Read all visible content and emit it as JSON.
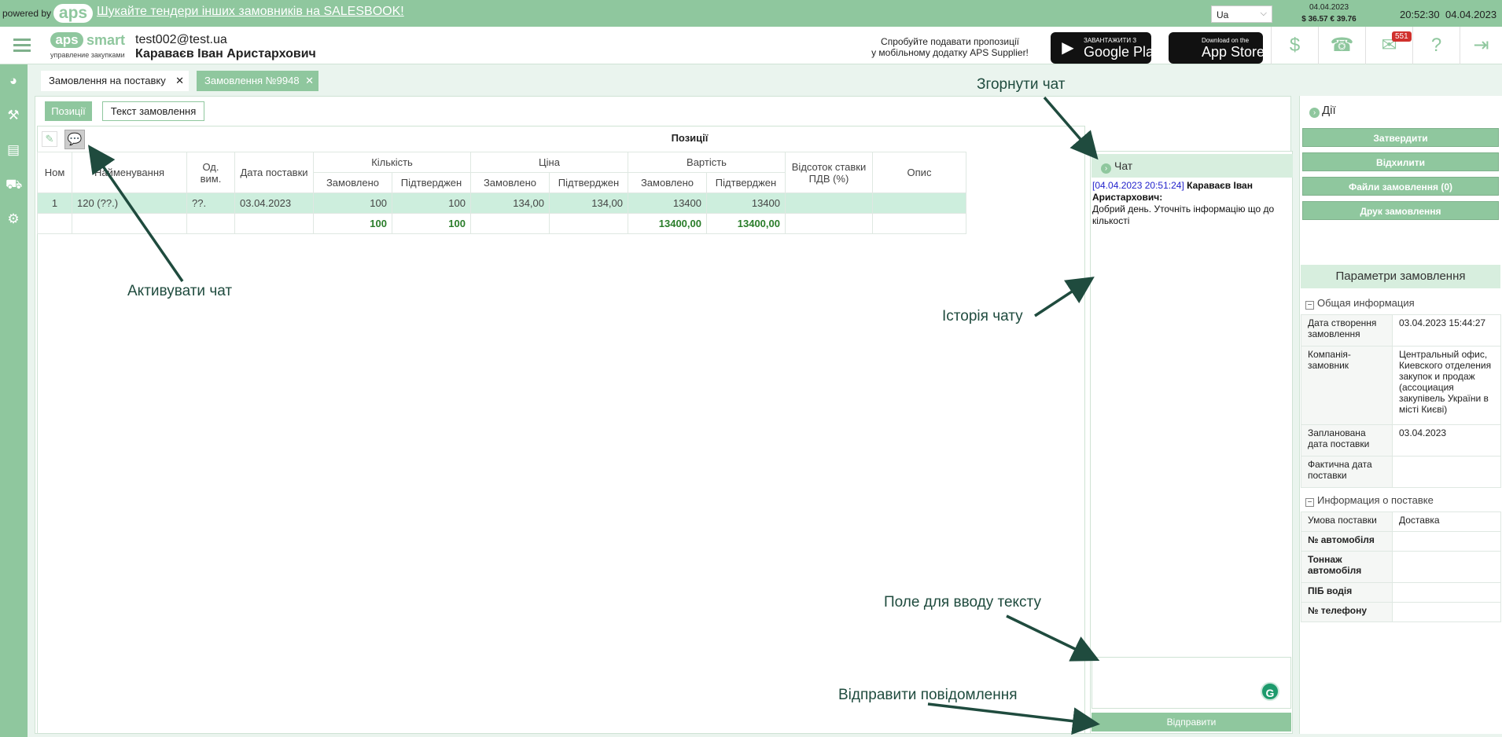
{
  "topbar": {
    "powered_by": "powered by",
    "logo": "aps",
    "promo_link": "Шукайте тендери інших замовників на SALESBOOK!",
    "language": "Ua",
    "rates_date": "04.04.2023",
    "rates": "$ 36.57  € 39.76",
    "time": "20:52:30",
    "date": "04.04.2023"
  },
  "header": {
    "brand_aps": "aps",
    "brand_smart": "smart",
    "brand_tagline": "управление закупками",
    "user_email": "test002@test.ua",
    "user_name": "Караваєв Іван Аристархович",
    "mobile_promo_1": "Спробуйте подавати пропозиції",
    "mobile_promo_2": "у мобільному додатку APS Supplier!",
    "google_small": "ЗАВАНТАЖИТИ З",
    "google_large": "Google Play",
    "apple_small": "Download on the",
    "apple_large": "App Store",
    "mail_badge": "551"
  },
  "tabs": [
    {
      "label": "Замовлення на поставку"
    },
    {
      "label": "Замовлення №9948"
    }
  ],
  "subtabs": {
    "positions": "Позиції",
    "order_text": "Текст замовлення"
  },
  "grid": {
    "title": "Позиції",
    "columns": {
      "num": "Ном",
      "name": "Найменування",
      "unit": "Од. вим.",
      "delivery_date": "Дата поставки",
      "quantity": "Кількість",
      "price": "Ціна",
      "cost": "Вартість",
      "vat": "Відсоток ставки ПДВ (%)",
      "description": "Опис",
      "ordered": "Замовлено",
      "confirmed": "Підтверджен"
    },
    "rows": [
      {
        "num": "1",
        "name": "120 (??.)",
        "unit": "??.",
        "date": "03.04.2023",
        "qty_ordered": "100",
        "qty_confirmed": "100",
        "price_ordered": "134,00",
        "price_confirmed": "134,00",
        "cost_ordered": "13400",
        "cost_confirmed": "13400"
      }
    ],
    "totals": {
      "qty_ordered": "100",
      "qty_confirmed": "100",
      "cost_ordered": "13400,00",
      "cost_confirmed": "13400,00"
    }
  },
  "chat": {
    "title": "Чат",
    "message": {
      "timestamp": "[04.04.2023 20:51:24]",
      "author": "Караваєв Іван Аристархович:",
      "text": "Добрий день. Уточніть інформацію що до кількості"
    },
    "send_label": "Відправити"
  },
  "actions": {
    "title": "Дії",
    "approve": "Затвердити",
    "reject": "Відхилити",
    "files": "Файли замовлення (0)",
    "print": "Друк замовлення"
  },
  "params": {
    "title": "Параметри замовлення",
    "general_section": "Общая информация",
    "general": [
      {
        "k": "Дата створення замовлення",
        "v": "03.04.2023 15:44:27"
      },
      {
        "k": "Компанія-замовник",
        "v": "Центральный офис, Киевского отделения закупок и продаж (ассоциация закупівель України в місті Києві)"
      },
      {
        "k": "Запланована дата поставки",
        "v": "03.04.2023"
      },
      {
        "k": "Фактична дата поставки",
        "v": ""
      }
    ],
    "delivery_section": "Информация о поставке",
    "delivery": [
      {
        "k": "Умова поставки",
        "v": "Доставка"
      },
      {
        "k": "№ автомобіля",
        "v": ""
      },
      {
        "k": "Тоннаж автомобіля",
        "v": ""
      },
      {
        "k": "ПІБ водія",
        "v": ""
      },
      {
        "k": "№ телефону",
        "v": ""
      }
    ]
  },
  "annotations": {
    "collapse_chat": "Згорнути чат",
    "activate_chat": "Активувати чат",
    "chat_history": "Історія чату",
    "text_input": "Поле для вводу тексту",
    "send_message": "Відправити повідомлення"
  },
  "colors": {
    "brand": "#8fc79e",
    "arrow": "#1f4b3e",
    "badge": "#d0312d"
  }
}
